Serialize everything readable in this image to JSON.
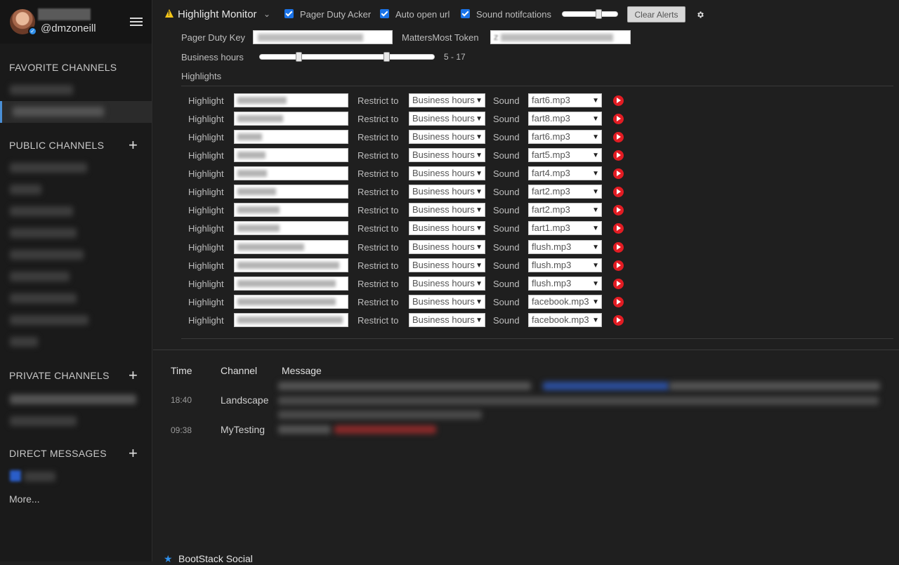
{
  "sidebar": {
    "username": "@dmzoneill",
    "sections": {
      "favorite": "FAVORITE CHANNELS",
      "public": "PUBLIC CHANNELS",
      "private": "PRIVATE CHANNELS",
      "direct": "DIRECT MESSAGES"
    },
    "more_label": "More..."
  },
  "header": {
    "title": "Highlight Monitor",
    "pager_duty_acker": {
      "label": "Pager Duty Acker",
      "checked": true
    },
    "auto_open_url": {
      "label": "Auto open url",
      "checked": true
    },
    "sound_notifications": {
      "label": "Sound notifcations",
      "checked": true
    },
    "volume_fraction": 0.65,
    "clear_alerts_label": "Clear Alerts"
  },
  "settings": {
    "pager_duty_key_label": "Pager Duty Key",
    "mattermost_token_label": "MattersMost Token",
    "mattermost_token_prefix": "z",
    "business_hours_label": "Business hours",
    "business_hours_range": "5 - 17",
    "business_hours_start": 5,
    "business_hours_end": 17,
    "highlights_label": "Highlights"
  },
  "highlight_row_labels": {
    "highlight": "Highlight",
    "restrict_to": "Restrict to",
    "sound": "Sound"
  },
  "highlights": [
    {
      "restrict": "Business hours",
      "sound": "fart6.mp3"
    },
    {
      "restrict": "Business hours",
      "sound": "fart8.mp3"
    },
    {
      "restrict": "Business hours",
      "sound": "fart6.mp3"
    },
    {
      "restrict": "Business hours",
      "sound": "fart5.mp3"
    },
    {
      "restrict": "Business hours",
      "sound": "fart4.mp3"
    },
    {
      "restrict": "Business hours",
      "sound": "fart2.mp3"
    },
    {
      "restrict": "Business hours",
      "sound": "fart2.mp3"
    },
    {
      "restrict": "Business hours",
      "sound": "fart1.mp3"
    },
    {
      "restrict": "Business hours",
      "sound": "flush.mp3"
    },
    {
      "restrict": "Business hours",
      "sound": "flush.mp3"
    },
    {
      "restrict": "Business hours",
      "sound": "flush.mp3"
    },
    {
      "restrict": "Business hours",
      "sound": "facebook.mp3"
    },
    {
      "restrict": "Business hours",
      "sound": "facebook.mp3"
    }
  ],
  "log": {
    "columns": [
      "Time",
      "Channel",
      "Message"
    ],
    "rows": [
      {
        "time": "18:40",
        "channel": "Landscape"
      },
      {
        "time": "09:38",
        "channel": "MyTesting"
      }
    ]
  },
  "footer": {
    "channel_name": "BootStack Social"
  },
  "colors": {
    "accent": "#1a73e8",
    "play": "#e31c23",
    "warning": "#f5c518"
  }
}
